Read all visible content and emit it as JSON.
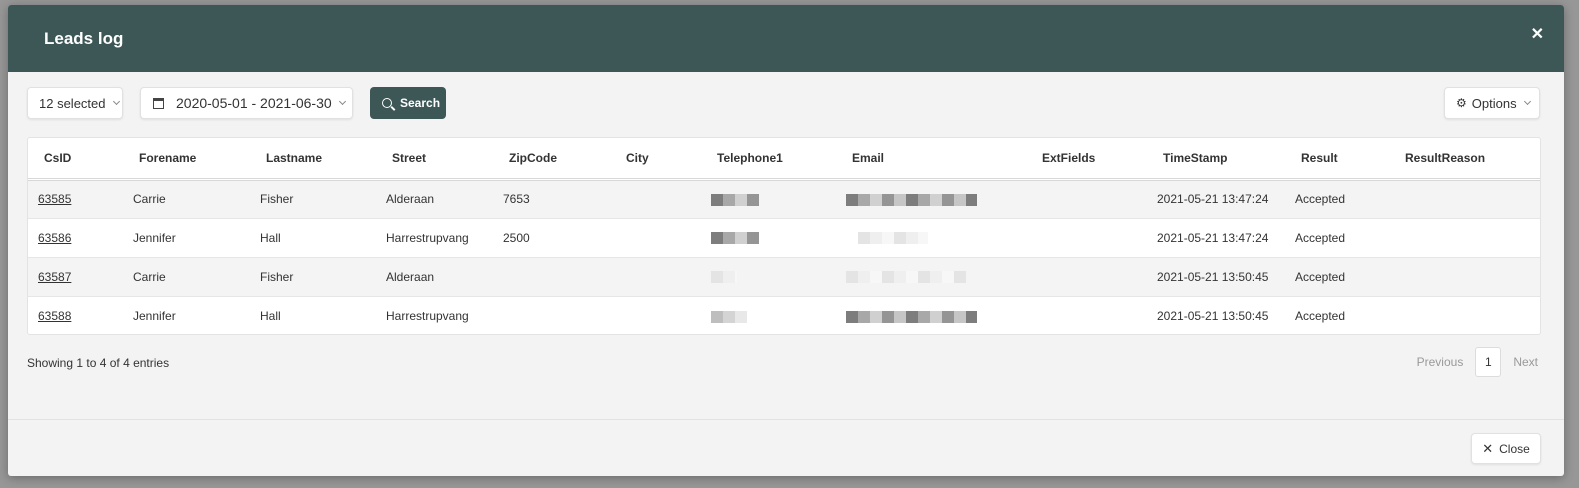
{
  "modal": {
    "title": "Leads log",
    "close_icon": "close-icon",
    "close_label": "Close"
  },
  "toolbar": {
    "select_label": "12 selected",
    "date_range": "2020-05-01 - 2021-06-30",
    "search_label": "Search",
    "options_label": "Options"
  },
  "table": {
    "columns": [
      "CsID",
      "Forename",
      "Lastname",
      "Street",
      "ZipCode",
      "City",
      "Telephone1",
      "Email",
      "ExtFields",
      "TimeStamp",
      "Result",
      "ResultReason"
    ],
    "rows": [
      {
        "csid": "63585",
        "forename": "Carrie",
        "lastname": "Fisher",
        "street": "Alderaan",
        "zipcode": "7653",
        "city": "",
        "extfields": "",
        "timestamp": "2021-05-21 13:47:24",
        "result": "Accepted",
        "resultreason": ""
      },
      {
        "csid": "63586",
        "forename": "Jennifer",
        "lastname": "Hall",
        "street": "Harrestrupvang",
        "zipcode": "2500",
        "city": "",
        "extfields": "",
        "timestamp": "2021-05-21 13:47:24",
        "result": "Accepted",
        "resultreason": ""
      },
      {
        "csid": "63587",
        "forename": "Carrie",
        "lastname": "Fisher",
        "street": "Alderaan",
        "zipcode": "",
        "city": "",
        "extfields": "",
        "timestamp": "2021-05-21 13:50:45",
        "result": "Accepted",
        "resultreason": ""
      },
      {
        "csid": "63588",
        "forename": "Jennifer",
        "lastname": "Hall",
        "street": "Harrestrupvang",
        "zipcode": "",
        "city": "",
        "extfields": "",
        "timestamp": "2021-05-21 13:50:45",
        "result": "Accepted",
        "resultreason": ""
      }
    ]
  },
  "footer": {
    "info": "Showing 1 to 4 of 4 entries",
    "previous": "Previous",
    "page": "1",
    "next": "Next"
  },
  "colors": {
    "header_bg": "#3d5757",
    "primary_button": "#3d5757"
  }
}
